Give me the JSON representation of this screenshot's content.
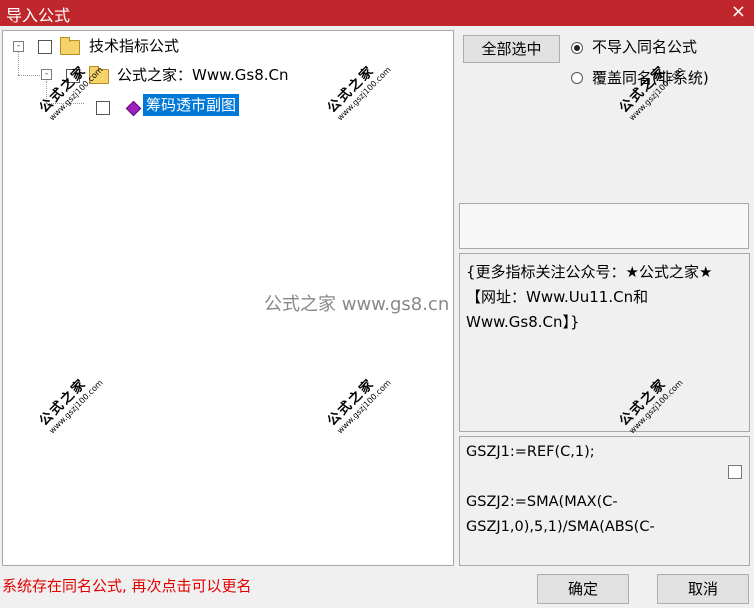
{
  "window": {
    "title": "导入公式",
    "close_glyph": "×"
  },
  "tree": {
    "root": {
      "expander": "-",
      "label": "技术指标公式"
    },
    "child": {
      "expander": "-",
      "label": "公式之家：Www.Gs8.Cn"
    },
    "leaf": {
      "label": "筹码透市副图"
    }
  },
  "controls": {
    "select_all": "全部选中",
    "radio_skip": "不导入同名公式",
    "radio_overwrite": "覆盖同名(非系统)",
    "selected_radio": "radio_skip"
  },
  "description": "{更多指标关注公众号：★公式之家★ 【网址：Www.Uu11.Cn和Www.Gs8.Cn】}",
  "code_lines": [
    "GSZJ1:=REF(C,1);",
    "",
    "GSZJ2:=SMA(MAX(C-",
    "GSZJ1,0),5,1)/SMA(ABS(C-"
  ],
  "status": "系统存在同名公式, 再次点击可以更名",
  "buttons": {
    "ok": "确定",
    "cancel": "取消"
  },
  "watermark": {
    "center": "公式之家 www.gs8.cn",
    "stamp_main": "公式之家",
    "stamp_url": "www.gszj100.com"
  }
}
